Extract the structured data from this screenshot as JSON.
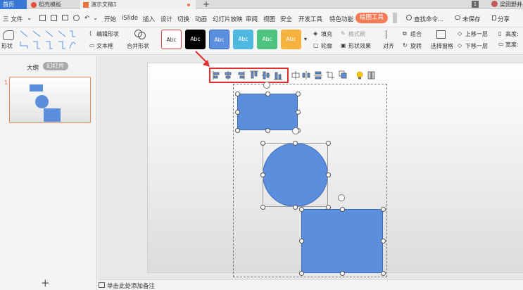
{
  "tabs": {
    "home": "首页",
    "template": "稻壳模板",
    "doc": "演示文稿1",
    "user": "梁田野井"
  },
  "menu": {
    "file": "三 文件",
    "items": [
      "开始",
      "iSlide",
      "插入",
      "设计",
      "切换",
      "动画",
      "幻灯片放映",
      "审阅",
      "视图",
      "安全",
      "开发工具",
      "特色功能"
    ],
    "active": "绘图工具",
    "search": "查找命令...",
    "save_status": "未保存",
    "share": "分享"
  },
  "ribbon": {
    "shape_label": "形状",
    "edit_shape": "编辑形状",
    "text_box": "文本框",
    "merge_shape": "合并形状",
    "style_samples": [
      "Abc",
      "Abc",
      "Abc",
      "Abc",
      "Abc",
      "Abc"
    ],
    "style_colors": [
      "#ffffff",
      "#000000",
      "#5b8fde",
      "#4fb8e0",
      "#4ec27f",
      "#f5b23f"
    ],
    "fill": "填充",
    "format_painter": "格式刷",
    "outline": "轮廓",
    "shape_effect": "形状效果",
    "align": "对齐",
    "group": "组合",
    "rotate": "旋转",
    "selection_pane": "选择窗格",
    "bring_forward": "上移一层",
    "send_backward": "下移一层",
    "height": "高度:",
    "width": "宽度:"
  },
  "left_panel": {
    "outline_tab": "大纲",
    "slides_tab": "幻灯片",
    "slide_number": "1",
    "add_icon": "+"
  },
  "notes": {
    "placeholder": "单击此处添加备注"
  },
  "colors": {
    "accent": "#f07b56",
    "shape_fill": "#5b8fde",
    "shape_stroke": "#3c6bb7",
    "highlight": "#e03030"
  }
}
